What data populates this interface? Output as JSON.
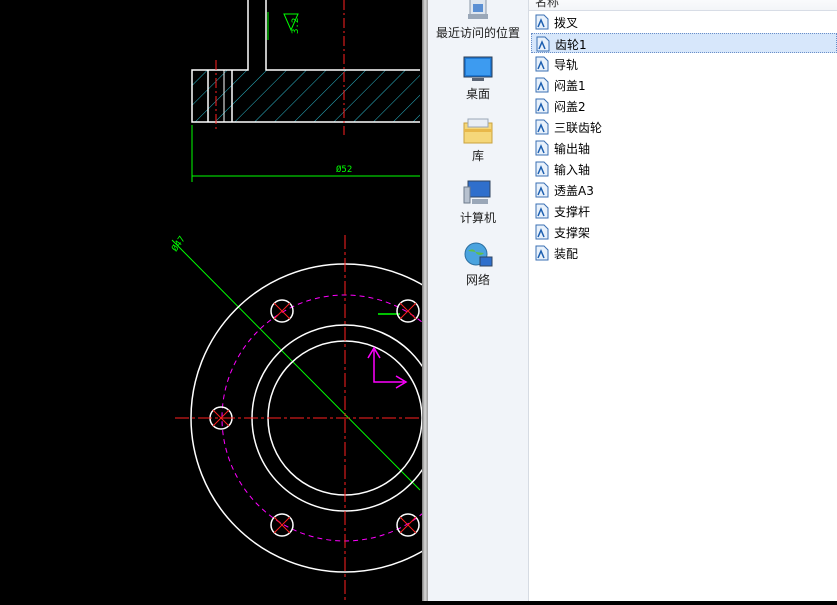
{
  "cad": {
    "dimension_top": "Ø52",
    "dimension_diag": "Ø47",
    "dimension_vertical": "3.2",
    "colors": {
      "background": "#000000",
      "outline": "#ffffff",
      "centerline": "#ff2020",
      "dimension": "#00ff00",
      "hatch": "#2bb6c8",
      "bolt_circle": "#ff00ff"
    }
  },
  "nav": {
    "items": [
      {
        "label": "最近访问的位置",
        "icon": "recent-places-icon"
      },
      {
        "label": "桌面",
        "icon": "desktop-icon"
      },
      {
        "label": "库",
        "icon": "library-icon"
      },
      {
        "label": "计算机",
        "icon": "computer-icon"
      },
      {
        "label": "网络",
        "icon": "network-icon"
      }
    ]
  },
  "files": {
    "column_name": "名称",
    "selected_index": 1,
    "items": [
      "拨叉",
      "齿轮1",
      "导轨",
      "闷盖1",
      "闷盖2",
      "三联齿轮",
      "输出轴",
      "输入轴",
      "透盖A3",
      "支撑杆",
      "支撑架",
      "装配"
    ]
  }
}
